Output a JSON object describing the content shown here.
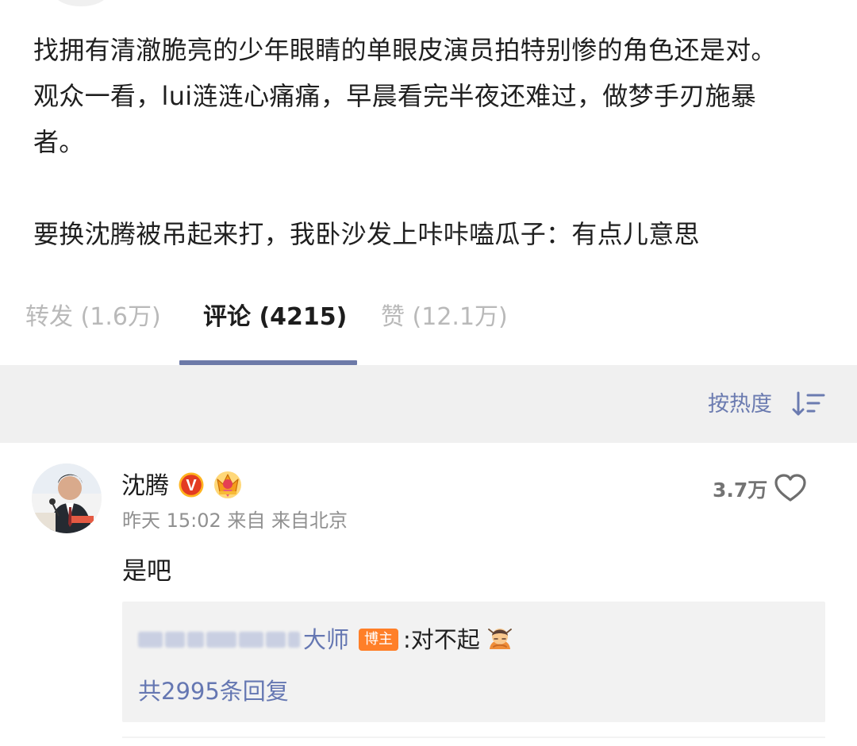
{
  "post": {
    "text": "找拥有清澈脆亮的少年眼睛的单眼皮演员拍特别惨的角色还是对。\n观众一看，lui涟涟心痛痛，早晨看完半夜还难过，做梦手刃施暴\n者。\n\n要换沈腾被吊起来打，我卧沙发上咔咔嗑瓜子：有点儿意思"
  },
  "tabs": [
    {
      "label": "转发 (1.6万)",
      "active": false
    },
    {
      "label": "评论 (4215)",
      "active": true
    },
    {
      "label": "赞 (12.1万)",
      "active": false
    }
  ],
  "sort": {
    "label": "按热度",
    "icon": "sort-icon"
  },
  "comment": {
    "username": "沈腾",
    "verified_badge_letter": "V",
    "meta": "昨天 15:02 来自 来自北京",
    "likes": "3.7万",
    "text": "是吧",
    "reply": {
      "name_tail": "大师",
      "role_badge": "博主",
      "text": ":对不起",
      "emoji": "bowing-person-emoji"
    },
    "reply_count": "共2995条回复"
  },
  "colors": {
    "link": "#6577b2",
    "active_tab_underline": "#6d7aa8",
    "badge_orange": "#ff7f28",
    "verified_red": "#e33b21",
    "gray_text": "#909090"
  }
}
